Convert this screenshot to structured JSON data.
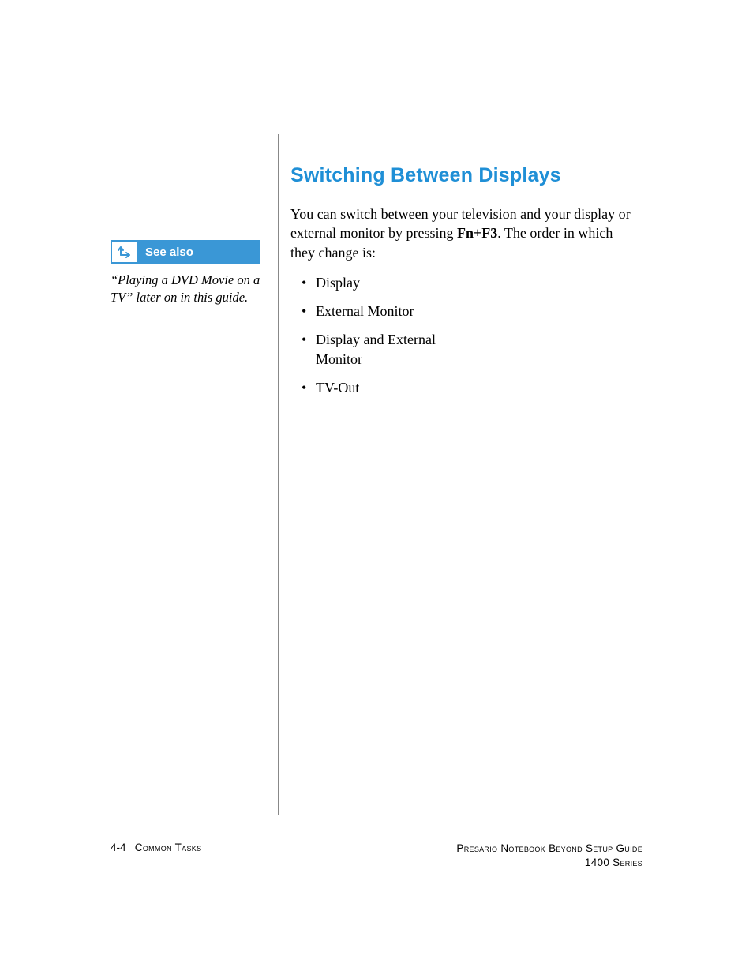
{
  "sidebar": {
    "seealso_label": "See also",
    "seealso_text": "“Playing a DVD Movie on a TV” later on in this guide."
  },
  "main": {
    "heading": "Switching Between Displays",
    "para_before": "You can switch between your television and your display or external monitor by pressing ",
    "para_key": "Fn+F3",
    "para_after": ". The order in which they change is:",
    "bullets": [
      "Display",
      "External Monitor",
      "Display and External Monitor",
      "TV-Out"
    ]
  },
  "footer": {
    "page_num": "4-4",
    "section": "Common Tasks",
    "right_line1": "Presario Notebook Beyond Setup Guide",
    "right_line2": "1400 Series"
  }
}
